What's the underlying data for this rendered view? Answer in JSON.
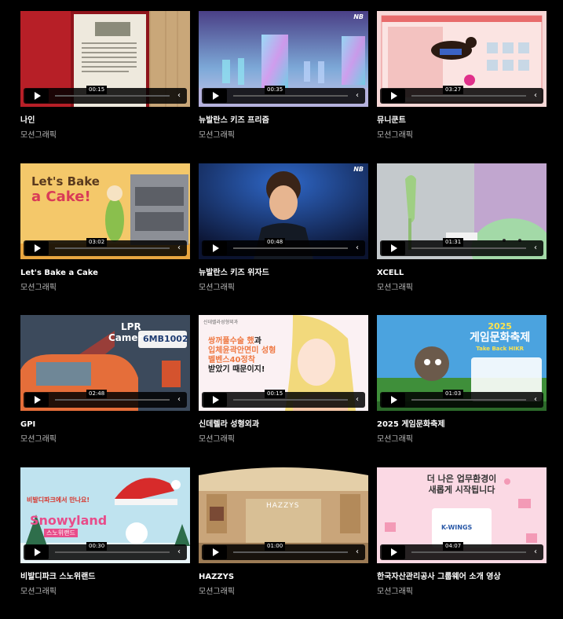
{
  "items": [
    {
      "title": "나인",
      "category": "모션그래픽",
      "time": "00:15"
    },
    {
      "title": "뉴발란스 키즈 프리즘",
      "category": "모션그래픽",
      "time": "00:35"
    },
    {
      "title": "뮤니쿤트",
      "category": "모션그래픽",
      "time": "03:27"
    },
    {
      "title": "Let's Bake a Cake",
      "category": "모션그래픽",
      "time": "03:02"
    },
    {
      "title": "뉴발란스 키즈 위자드",
      "category": "모션그래픽",
      "time": "00:48"
    },
    {
      "title": "XCELL",
      "category": "모션그래픽",
      "time": "01:31"
    },
    {
      "title": "GPI",
      "category": "모션그래픽",
      "time": "02:48"
    },
    {
      "title": "신데렐라 성형외과",
      "category": "모션그래픽",
      "time": "00:15"
    },
    {
      "title": "2025 게임문화축제",
      "category": "모션그래픽",
      "time": "01:03"
    },
    {
      "title": "비발디파크 스노위랜드",
      "category": "모션그래픽",
      "time": "00:30"
    },
    {
      "title": "HAZZYS",
      "category": "모션그래픽",
      "time": "01:00"
    },
    {
      "title": "한국자산관리공사 그룹웨어 소개 영상",
      "category": "모션그래픽",
      "time": "04:07"
    }
  ],
  "thumb_text": {
    "bake1": "Let's Bake",
    "bake2": "a Cake!",
    "lpr1": "LPR",
    "lpr2": "Camera",
    "plate": "6MB1002",
    "cind_logo": "신데렐라성형외과",
    "cind1": "쌍꺼풀수술 했",
    "cind2": "과",
    "cind3": "입체윤곽안면미 성형",
    "cind4": "벨벤스40정착",
    "cind5": "받았기 때문이지!",
    "game1": "2025",
    "game2": "게임문화축제",
    "game3": "Take Back HIKR",
    "snow1": "비발디파크에서 만나요!",
    "snow2": "Snowyland",
    "snow3": "스노위랜드",
    "hazzys": "HAZZYS",
    "kamco1": "더 나은 업무환경이",
    "kamco2": "새롭게 시작됩니다",
    "kwings": "K-WINGS",
    "nb": "NB"
  },
  "colors": {
    "accent_red": "#e34a4a",
    "pink": "#f6a1c3"
  }
}
